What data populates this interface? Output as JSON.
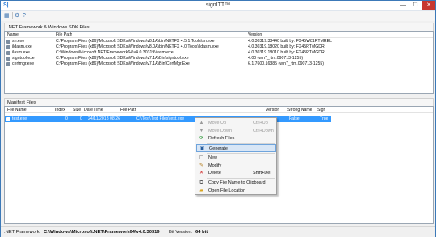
{
  "window": {
    "title": "signITT™",
    "app_icon": "S|",
    "min": "—",
    "max": "☐",
    "close": "✕"
  },
  "toolbar": {
    "icons": [
      "grid-icon",
      "tools-icon",
      "help-icon"
    ],
    "glyphs": [
      "▦",
      "⚙",
      "?"
    ]
  },
  "sdk": {
    "section_title": ".NET Framework & Windows SDK Files",
    "columns": [
      "Name",
      "File Path",
      "Version"
    ],
    "rows": [
      {
        "name": "sn.exe",
        "path": "C:\\Program Files (x86)\\Microsoft SDKs\\Windows\\v8.1A\\bin\\NETFX 4.5.1 Tools\\sn.exe",
        "version": "4.0.30319.33440 built by: FX45W81RTMREL"
      },
      {
        "name": "ildasm.exe",
        "path": "C:\\Program Files (x86)\\Microsoft SDKs\\Windows\\v8.0A\\bin\\NETFX 4.0 Tools\\ildasm.exe",
        "version": "4.0.30319.18020 built by: FX45RTMGDR"
      },
      {
        "name": "ilasm.exe",
        "path": "C:\\Windows\\Microsoft.NET\\Framework64\\v4.0.30319\\ilasm.exe",
        "version": "4.0.30319.18010 built by: FX45RTMGDR"
      },
      {
        "name": "signtool.exe",
        "path": "C:\\Program Files (x86)\\Microsoft SDKs\\Windows\\v7.1A\\Bin\\signtool.exe",
        "version": "4.00 (win7_rtm.090713-1255)"
      },
      {
        "name": "certmgr.exe",
        "path": "C:\\Program Files (x86)\\Microsoft SDKs\\Windows\\v7.1A\\Bin\\CertMgr.Exe",
        "version": "6.1.7600.16385 (win7_rtm.090713-1255)"
      }
    ]
  },
  "manifest": {
    "section_title": "Manifest Files",
    "columns": [
      "File Name",
      "Index",
      "Size",
      "Date Time",
      "File Path",
      "Version",
      "Strong Name",
      "Sign"
    ],
    "rows": [
      {
        "name": "test.exe",
        "index": "0",
        "size": "0",
        "datetime": "24/11/2013 08:26",
        "path": "C:\\Test\\Test Files\\test.exe",
        "version": "",
        "strong_name": "False",
        "sign": "True"
      }
    ]
  },
  "context_menu": {
    "items": [
      {
        "icon": "move-up-icon",
        "glyph": "▲",
        "label": "Move Up",
        "shortcut": "Ctrl+Up",
        "disabled": true
      },
      {
        "icon": "move-down-icon",
        "glyph": "▼",
        "label": "Move Down",
        "shortcut": "Ctrl+Down",
        "disabled": true
      },
      {
        "icon": "refresh-icon",
        "glyph": "⟳",
        "label": "Refresh Files",
        "shortcut": "",
        "disabled": false
      },
      {
        "icon": "generate-icon",
        "glyph": "▣",
        "label": "Generate",
        "shortcut": "",
        "disabled": false,
        "highlighted": true
      },
      {
        "icon": "new-icon",
        "glyph": "▢",
        "label": "New",
        "shortcut": "",
        "disabled": false
      },
      {
        "icon": "modify-icon",
        "glyph": "✎",
        "label": "Modify",
        "shortcut": "",
        "disabled": false
      },
      {
        "icon": "delete-icon",
        "glyph": "✕",
        "label": "Delete",
        "shortcut": "Shift+Del",
        "disabled": false
      },
      {
        "icon": "copy-icon",
        "glyph": "⧉",
        "label": "Copy File Name to Clipboard",
        "shortcut": "",
        "disabled": false
      },
      {
        "icon": "folder-icon",
        "glyph": "▰",
        "label": "Open File Location",
        "shortcut": "",
        "disabled": false
      }
    ]
  },
  "status": {
    "framework_label": ".NET Framework:",
    "framework_value": "C:\\Windows\\Microsoft.NET\\Framework64\\v4.0.30319",
    "bit_label": "Bit Version:",
    "bit_value": "64 bit"
  },
  "colors": {
    "selection": "#3399ff",
    "close_button": "#c7372f",
    "highlight": "#d8e6f6"
  }
}
